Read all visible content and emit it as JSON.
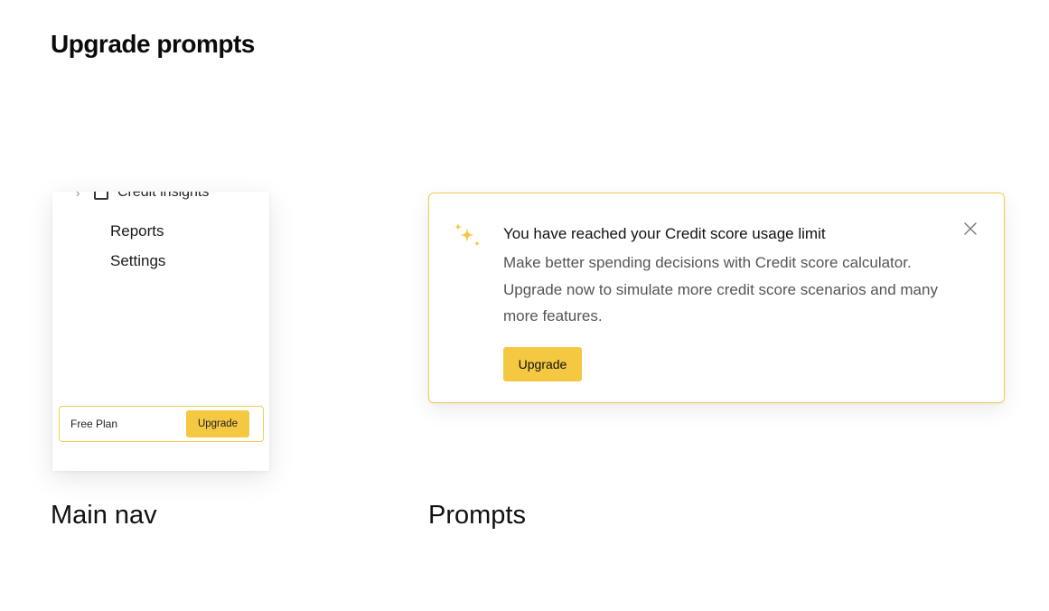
{
  "page": {
    "title": "Upgrade prompts"
  },
  "main_nav": {
    "partial_item": {
      "label": "Credit insights",
      "icon": "chevron-right-icon"
    },
    "items": [
      {
        "label": "Reports"
      },
      {
        "label": "Settings"
      }
    ],
    "plan": {
      "label": "Free Plan",
      "upgrade_label": "Upgrade"
    },
    "caption": "Main nav"
  },
  "prompt": {
    "title": "You have reached your Credit score usage limit",
    "body": "Make better spending decisions with Credit score calculator. Upgrade now to simulate more credit score scenarios and many more features.",
    "upgrade_label": "Upgrade",
    "caption": "Prompts",
    "icons": {
      "sparkle": "sparkle-icon",
      "close": "close-icon"
    }
  },
  "colors": {
    "accent": "#f5c842",
    "border": "#f3cd4e",
    "body_text": "#555555"
  }
}
